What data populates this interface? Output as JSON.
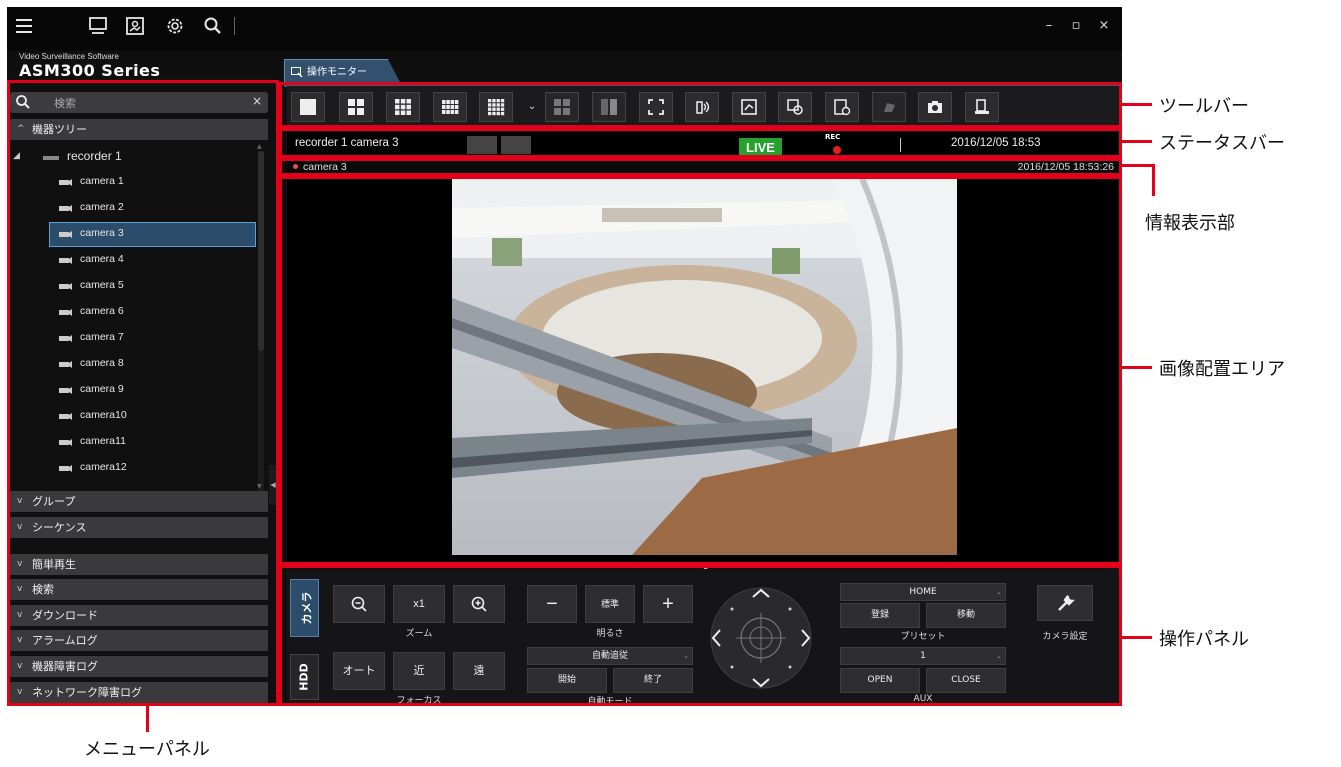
{
  "titlebar": {
    "icons": [
      "menu-icon",
      "monitor-icon",
      "map-icon",
      "gear-icon",
      "search-icon"
    ],
    "window_controls": {
      "minimize": "–",
      "maximize": "▫",
      "close": "×"
    }
  },
  "brand": {
    "subtitle": "Video Surveillance Software",
    "title": "ASM300 Series"
  },
  "tab": {
    "label": "操作モニター"
  },
  "sidebar": {
    "search_placeholder": "検索",
    "search_clear": "×",
    "tree_header": "機器ツリー",
    "recorder": "recorder 1",
    "cameras": [
      "camera 1",
      "camera 2",
      "camera 3",
      "camera 4",
      "camera 5",
      "camera 6",
      "camera 7",
      "camera 8",
      "camera 9",
      "camera10",
      "camera11",
      "camera12"
    ],
    "selected_camera": "camera 3",
    "sections_upper": [
      "グループ",
      "シーケンス"
    ],
    "sections_lower": [
      "簡単再生",
      "検索",
      "ダウンロード",
      "アラームログ",
      "機器障害ログ",
      "ネットワーク障害ログ"
    ]
  },
  "toolbar": {
    "buttons": [
      "layout-1-icon",
      "layout-4-icon",
      "layout-9-icon",
      "layout-12-icon",
      "layout-16-icon",
      "layout-dropdown-icon",
      "sequence-icon",
      "split-icon",
      "fullscreen-icon",
      "audio-icon",
      "map-icon",
      "zoom-icon",
      "settings-icon",
      "hand-icon",
      "snapshot-icon",
      "print-icon"
    ]
  },
  "status": {
    "camera": "recorder 1 camera 3",
    "live": "LIVE",
    "rec": "REC",
    "datetime": "2016/12/05 18:53"
  },
  "info": {
    "camera": "camera 3",
    "datetime": "2016/12/05 18:53:26"
  },
  "panel": {
    "tab_camera": "カメラ",
    "tab_hdd": "HDD",
    "zoom_label": "ズーム",
    "zoom_value": "x1",
    "focus_label": "フォーカス",
    "focus_auto": "オート",
    "focus_near": "近",
    "focus_far": "遠",
    "brightness_label": "明るさ",
    "brightness_reset": "標準",
    "auto_mode_select": "自動追従",
    "auto_start": "開始",
    "auto_end": "終了",
    "auto_mode_label": "自動モード",
    "preset_select": "HOME",
    "preset_register": "登録",
    "preset_move": "移動",
    "preset_label": "プリセット",
    "aux_select": "1",
    "aux_open": "OPEN",
    "aux_close": "CLOSE",
    "aux_label": "AUX",
    "camera_settings": "カメラ設定"
  },
  "callouts": {
    "toolbar": "ツールバー",
    "statusbar": "ステータスバー",
    "info": "情報表示部",
    "image_area": "画像配置エリア",
    "op_panel": "操作パネル",
    "menu_panel": "メニューパネル"
  },
  "colors": {
    "callout": "#e3001b",
    "live": "#25a12d",
    "accent": "#2c4c6c",
    "rec": "#e02020"
  }
}
